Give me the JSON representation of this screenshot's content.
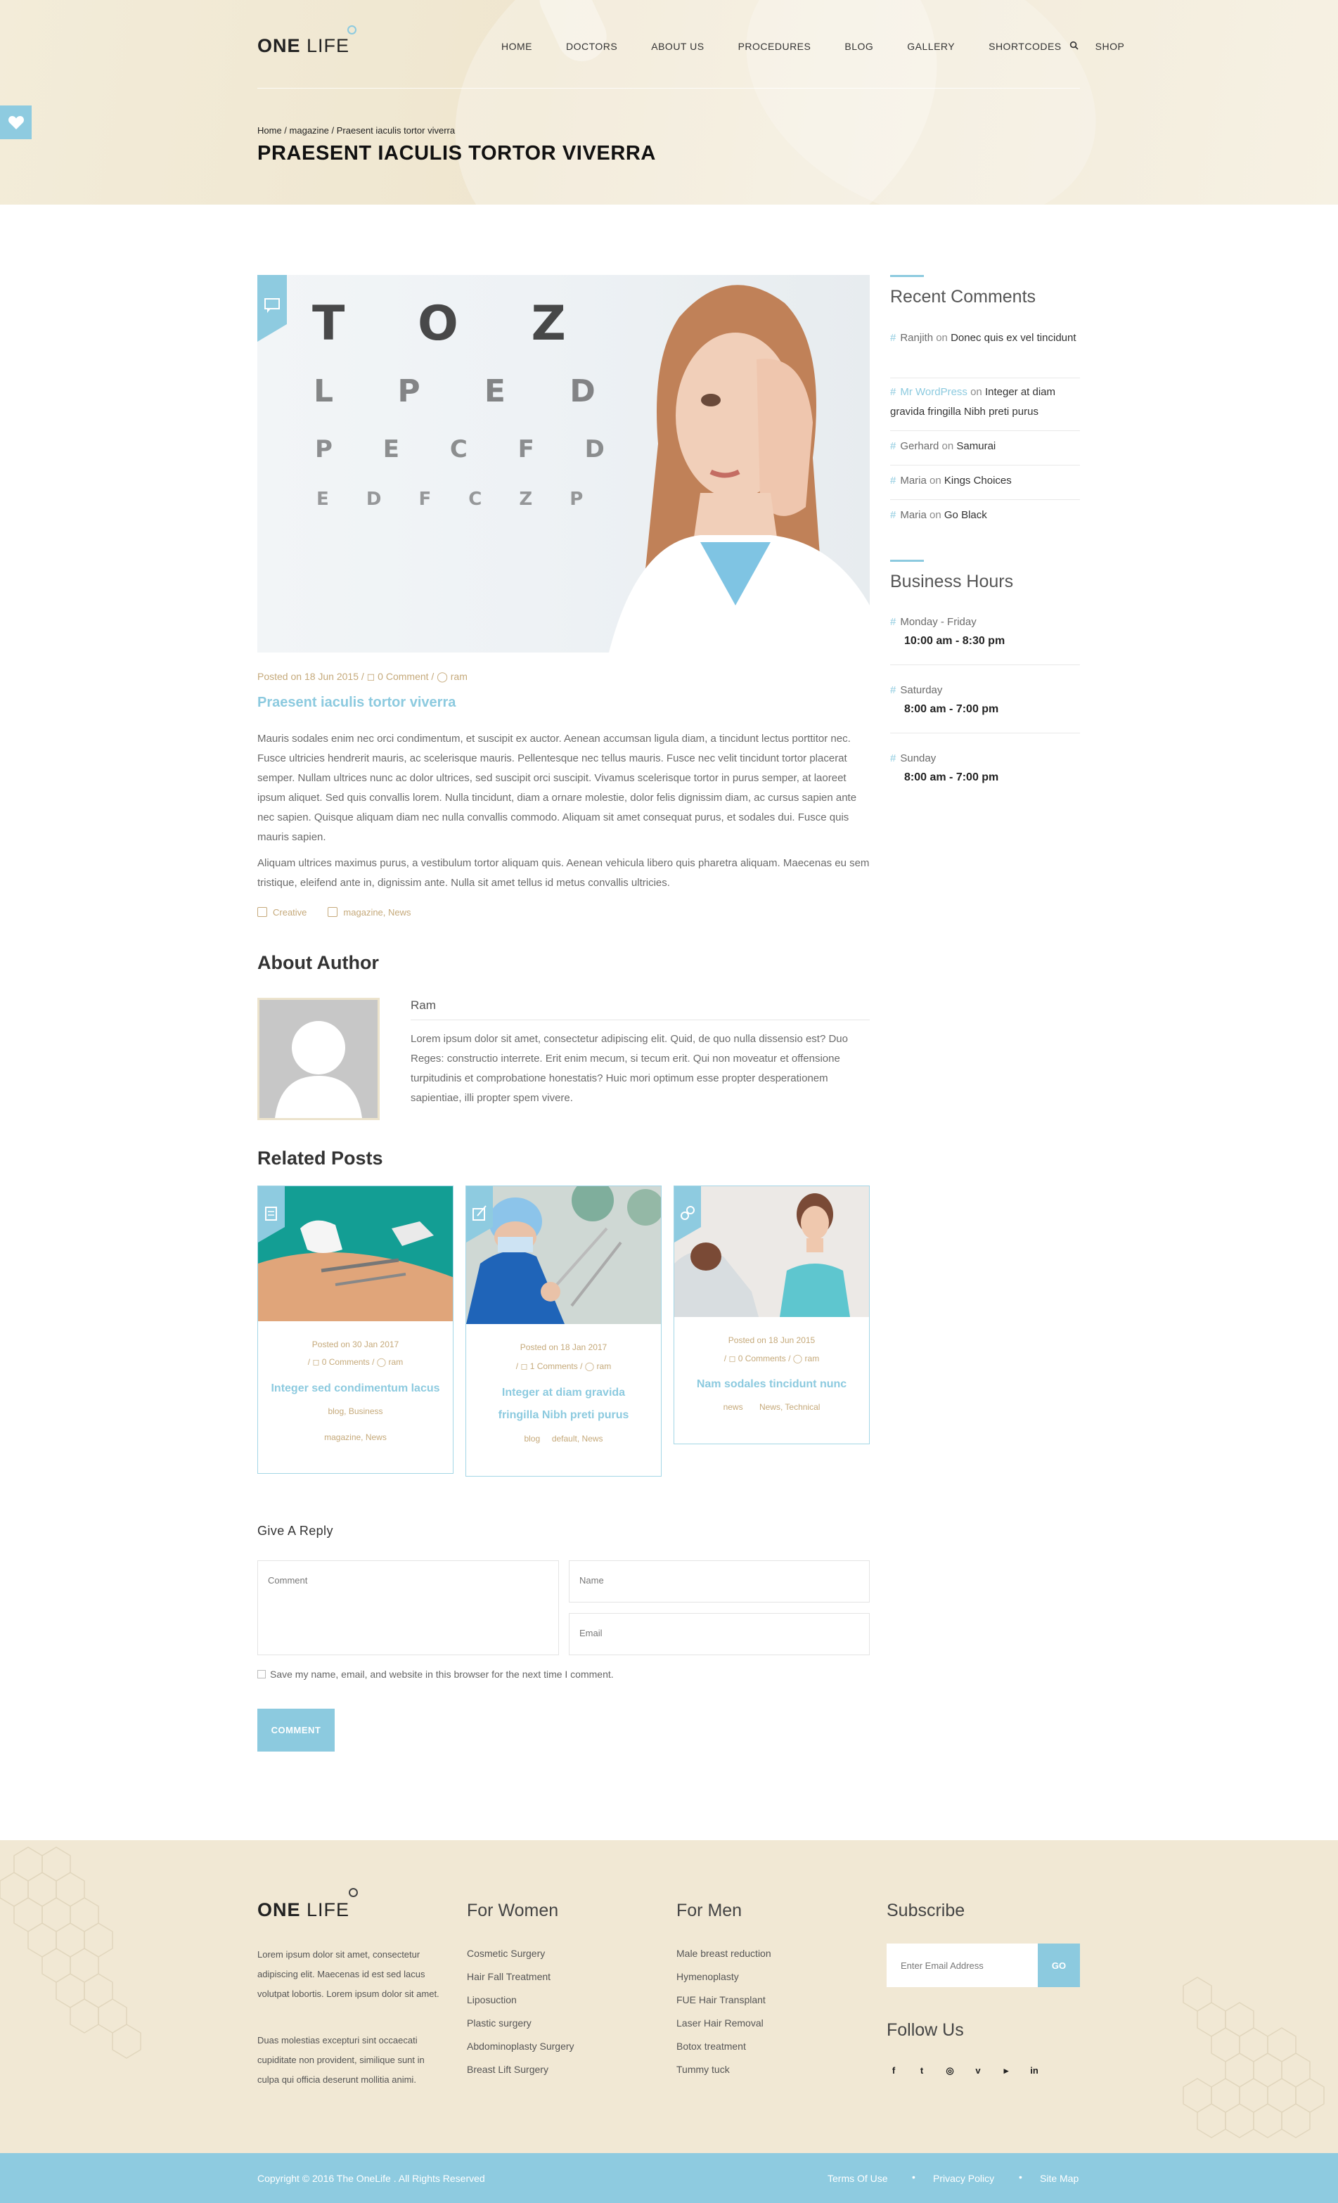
{
  "header": {
    "logo_bold": "ONE",
    "logo_light": "LIFE",
    "nav": [
      "HOME",
      "DOCTORS",
      "ABOUT US",
      "PROCEDURES",
      "BLOG",
      "GALLERY",
      "SHORTCODES",
      "SHOP"
    ],
    "breadcrumb": {
      "home": "Home",
      "sep1": " / ",
      "category": "magazine",
      "sep2": " / ",
      "current": "Praesent iaculis tortor viverra"
    },
    "page_title": "PRAESENT IACULIS TORTOR VIVERRA"
  },
  "post": {
    "meta": "Posted on 18 Jun 2015 / ◻ 0 Comment / ◯ ram",
    "title": "Praesent iaculis tortor viverra",
    "paragraph1": "Mauris sodales enim nec orci condimentum, et suscipit ex auctor. Aenean accumsan ligula diam, a tincidunt lectus porttitor nec. Fusce ultricies hendrerit mauris, ac scelerisque mauris. Pellentesque nec tellus mauris. Fusce nec velit tincidunt tortor placerat semper. Nullam ultrices nunc ac dolor ultrices, sed suscipit orci suscipit. Vivamus scelerisque tortor in purus semper, at laoreet ipsum aliquet. Sed quis convallis lorem. Nulla tincidunt, diam a ornare molestie, dolor felis dignissim diam, ac cursus sapien ante nec sapien. Quisque aliquam diam nec nulla convallis commodo. Aliquam sit amet consequat purus, et sodales dui. Fusce quis mauris sapien.",
    "paragraph2": "Aliquam ultrices maximus purus, a vestibulum tortor aliquam quis. Aenean vehicula libero quis pharetra aliquam. Maecenas eu sem tristique, eleifend ante in, dignissim ante. Nulla sit amet tellus id metus convallis ultricies.",
    "tag": "Creative",
    "categories": "magazine, News",
    "eye_chart": {
      "row1": "T O Z",
      "row2": "L P E D",
      "row3": "P E C F D",
      "row4": "E D F C Z P"
    }
  },
  "author": {
    "section_title": "About Author",
    "name": "Ram",
    "bio": "Lorem ipsum dolor sit amet, consectetur adipiscing elit. Quid, de quo nulla dissensio est? Duo Reges: constructio interrete. Erit enim mecum, si tecum erit. Qui non moveatur et offensione turpitudinis et comprobatione honestatis? Huic mori optimum esse propter desperationem sapientiae, illi propter spem vivere."
  },
  "related": {
    "section_title": "Related Posts",
    "posts": [
      {
        "date": "Posted on 30 Jan 2017",
        "meta": "/ ◻ 0 Comments / ◯ ram",
        "title": "Integer sed condimentum lacus",
        "tags": "blog, Business",
        "cats": "magazine, News"
      },
      {
        "date": "Posted on 18 Jan 2017",
        "meta": "/ ◻ 1 Comments / ◯ ram",
        "title": "Integer at diam gravida fringilla Nibh preti purus",
        "tags": "blog",
        "cats": "default, News"
      },
      {
        "date": "Posted on 18 Jun 2015",
        "meta": "/ ◻ 0 Comments / ◯ ram",
        "title": "Nam sodales tincidunt nunc",
        "tags": "news",
        "cats": "News, Technical"
      }
    ]
  },
  "reply": {
    "title": "Give A Reply",
    "comment_placeholder": "Comment",
    "name_placeholder": "Name",
    "email_placeholder": "Email",
    "save_label": "Save my name, email, and website in this browser for the next time I comment.",
    "submit_label": "COMMENT"
  },
  "sidebar": {
    "recent_title": "Recent Comments",
    "recent": [
      {
        "author": "Ranjith",
        "on": "on",
        "post": "Donec quis ex vel tincidunt",
        "accent": false
      },
      {
        "author": "Mr WordPress",
        "on": "on",
        "post": "Integer at diam gravida fringilla Nibh preti purus",
        "accent": true
      },
      {
        "author": "Gerhard",
        "on": "on",
        "post": "Samurai",
        "accent": false
      },
      {
        "author": "Maria",
        "on": "on",
        "post": "Kings Choices",
        "accent": false
      },
      {
        "author": "Maria",
        "on": "on",
        "post": "Go Black",
        "accent": false
      }
    ],
    "hours_title": "Business Hours",
    "hours": [
      {
        "day": "Monday - Friday",
        "time": "10:00 am - 8:30 pm"
      },
      {
        "day": "Saturday",
        "time": "8:00 am - 7:00 pm"
      },
      {
        "day": "Sunday",
        "time": "8:00 am - 7:00 pm"
      }
    ]
  },
  "footer": {
    "logo_bold": "ONE",
    "logo_light": "LIFE",
    "text1": "Lorem ipsum dolor sit amet, consectetur adipiscing elit. Maecenas id est sed lacus volutpat lobortis. Lorem ipsum dolor sit amet.",
    "text2": "Duas molestias excepturi sint occaecati cupiditate non provident, similique sunt in culpa qui officia deserunt mollitia animi.",
    "women_title": "For Women",
    "women_links": [
      "Cosmetic Surgery",
      "Hair Fall Treatment",
      "Liposuction",
      "Plastic surgery",
      "Abdominoplasty Surgery",
      "Breast Lift Surgery"
    ],
    "men_title": "For Men",
    "men_links": [
      "Male breast reduction",
      "Hymenoplasty",
      "FUE Hair Transplant",
      "Laser Hair Removal",
      "Botox treatment",
      "Tummy tuck"
    ],
    "subscribe_title": "Subscribe",
    "subscribe_placeholder": "Enter Email Address",
    "subscribe_button": "GO",
    "follow_title": "Follow Us",
    "social": [
      "f",
      "t",
      "◎",
      "v",
      "▸",
      "in"
    ],
    "copyright": "Copyright © 2016 The OneLife . All Rights Reserved",
    "bottom_links": [
      "Terms Of Use",
      "Privacy Policy",
      "Site Map"
    ],
    "bottom_sep": "•"
  },
  "colors": {
    "accent": "#8ccadf",
    "cream": "#f1e8d4",
    "gold": "#c5a97a"
  }
}
